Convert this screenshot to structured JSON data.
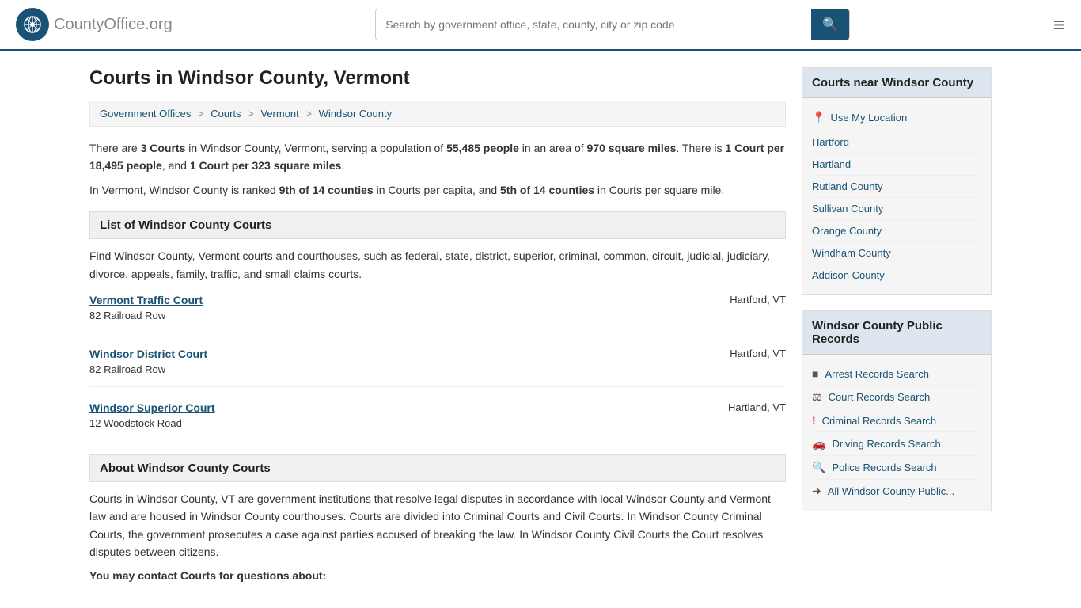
{
  "header": {
    "logo_text": "CountyOffice",
    "logo_suffix": ".org",
    "search_placeholder": "Search by government office, state, county, city or zip code",
    "menu_label": "Menu"
  },
  "page": {
    "title": "Courts in Windsor County, Vermont"
  },
  "breadcrumb": {
    "items": [
      {
        "label": "Government Offices",
        "href": "#"
      },
      {
        "label": "Courts",
        "href": "#"
      },
      {
        "label": "Vermont",
        "href": "#"
      },
      {
        "label": "Windsor County",
        "href": "#"
      }
    ]
  },
  "intro": {
    "text_before_count": "There are ",
    "count": "3 Courts",
    "text_after_count": " in Windsor County, Vermont, serving a population of ",
    "population": "55,485 people",
    "text_after_pop": " in an area of ",
    "area": "970 square miles",
    "text_per_capita": ". There is ",
    "per_capita": "1 Court per 18,495 people",
    "text_mid": ", and ",
    "per_sqmile": "1 Court per 323 square miles",
    "text_end": ".",
    "rank_text_before": "In Vermont, Windsor County is ranked ",
    "rank_capita": "9th of 14 counties",
    "rank_mid": " in Courts per capita, and ",
    "rank_sqmile": "5th of 14 counties",
    "rank_end": " in Courts per square mile."
  },
  "list_section": {
    "title": "List of Windsor County Courts",
    "description": "Find Windsor County, Vermont courts and courthouses, such as federal, state, district, superior, criminal, common, circuit, judicial, judiciary, divorce, appeals, family, traffic, and small claims courts."
  },
  "courts": [
    {
      "name": "Vermont Traffic Court",
      "address": "82 Railroad Row",
      "location": "Hartford, VT"
    },
    {
      "name": "Windsor District Court",
      "address": "82 Railroad Row",
      "location": "Hartford, VT"
    },
    {
      "name": "Windsor Superior Court",
      "address": "12 Woodstock Road",
      "location": "Hartland, VT"
    }
  ],
  "about_section": {
    "title": "About Windsor County Courts",
    "text": "Courts in Windsor County, VT are government institutions that resolve legal disputes in accordance with local Windsor County and Vermont law and are housed in Windsor County courthouses. Courts are divided into Criminal Courts and Civil Courts. In Windsor County Criminal Courts, the government prosecutes a case against parties accused of breaking the law. In Windsor County Civil Courts the Court resolves disputes between citizens.",
    "contact_label": "You may contact Courts for questions about:"
  },
  "sidebar": {
    "nearby_title": "Courts near Windsor County",
    "use_location_label": "Use My Location",
    "nearby_items": [
      {
        "label": "Hartford"
      },
      {
        "label": "Hartland"
      },
      {
        "label": "Rutland County"
      },
      {
        "label": "Sullivan County"
      },
      {
        "label": "Orange County"
      },
      {
        "label": "Windham County"
      },
      {
        "label": "Addison County"
      }
    ],
    "public_records_title": "Windsor County Public Records",
    "public_records_items": [
      {
        "label": "Arrest Records Search",
        "icon": "■"
      },
      {
        "label": "Court Records Search",
        "icon": "⚖"
      },
      {
        "label": "Criminal Records Search",
        "icon": "!"
      },
      {
        "label": "Driving Records Search",
        "icon": "🚗"
      },
      {
        "label": "Police Records Search",
        "icon": "🔍"
      },
      {
        "label": "All Windsor County Public...",
        "icon": "➜"
      }
    ]
  }
}
